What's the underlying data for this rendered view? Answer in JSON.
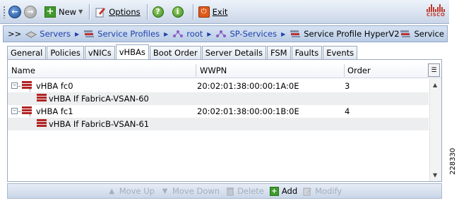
{
  "toolbar": {
    "new_label": "New",
    "options_label": "Options",
    "exit_label": "Exit",
    "logo_text": "CISCO"
  },
  "breadcrumb": {
    "prefix": ">>",
    "items": [
      "Servers",
      "Service Profiles",
      "root",
      "SP-Services"
    ],
    "current": "Service Profile HyperV2",
    "right_label": "Service"
  },
  "tabs": [
    "General",
    "Policies",
    "vNICs",
    "vHBAs",
    "Boot Order",
    "Server Details",
    "FSM",
    "Faults",
    "Events"
  ],
  "active_tab": "vHBAs",
  "table": {
    "columns": [
      "Name",
      "WWPN",
      "Order"
    ],
    "rows": [
      {
        "name": "vHBA fc0",
        "wwpn": "20:02:01:38:00:00:1A:0E",
        "order": "3"
      },
      {
        "name": "vHBA If FabricA-VSAN-60",
        "wwpn": "",
        "order": ""
      },
      {
        "name": "vHBA fc1",
        "wwpn": "20:02:01:38:00:00:1B:0E",
        "order": "4"
      },
      {
        "name": "vHBA If FabricB-VSAN-61",
        "wwpn": "",
        "order": ""
      }
    ]
  },
  "actions": {
    "move_up": "Move Up",
    "move_down": "Move Down",
    "delete": "Delete",
    "add": "Add",
    "modify": "Modify"
  },
  "figure_id": "228330"
}
